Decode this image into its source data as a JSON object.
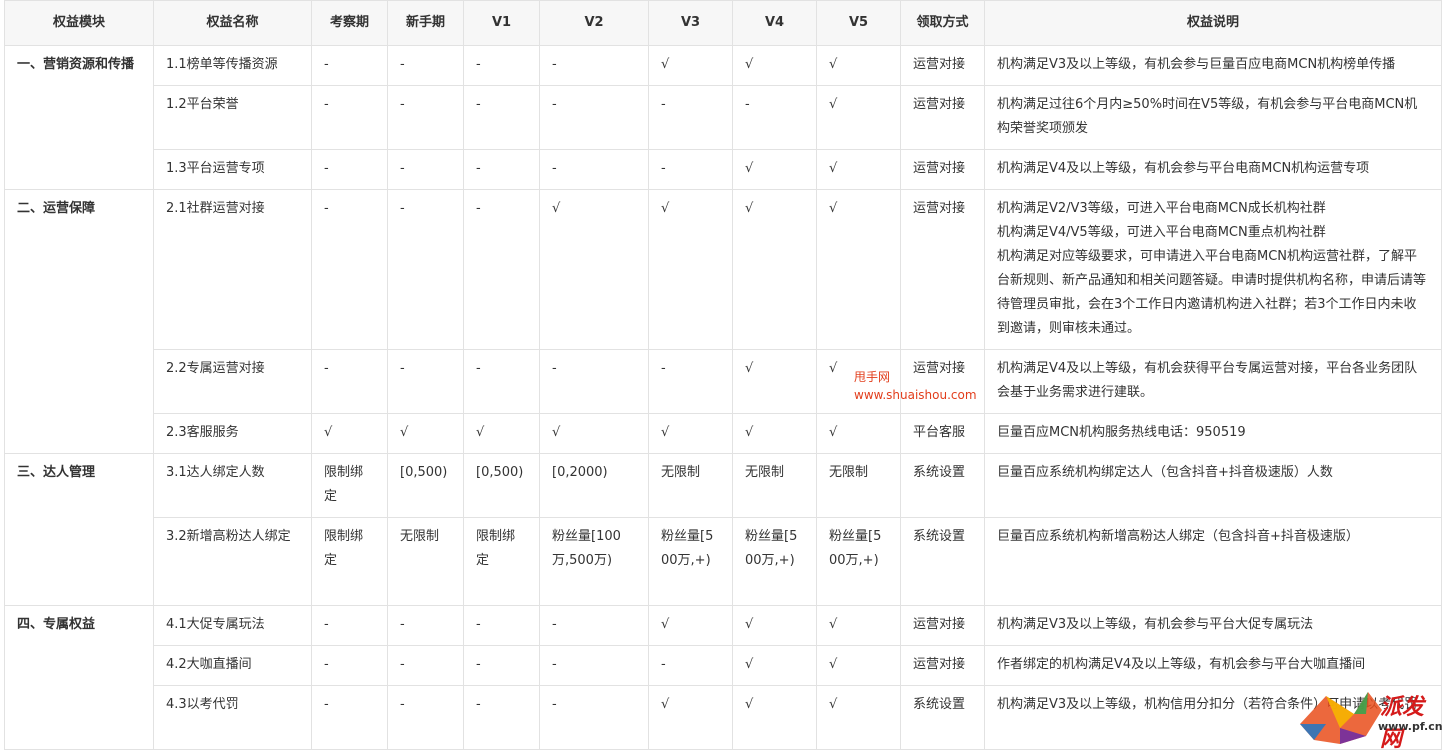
{
  "header": {
    "module": "权益模块",
    "name": "权益名称",
    "inspect": "考察期",
    "novice": "新手期",
    "v1": "V1",
    "v2": "V2",
    "v3": "V3",
    "v4": "V4",
    "v5": "V5",
    "method": "领取方式",
    "desc": "权益说明"
  },
  "modules": {
    "m1": "一、营销资源和传播",
    "m2": "二、运营保障",
    "m3": "三、达人管理",
    "m4": "四、专属权益"
  },
  "rows": [
    {
      "name": "1.1榜单等传播资源",
      "c": [
        "-",
        "-",
        "-",
        "-",
        "√",
        "√",
        "√"
      ],
      "method": "运营对接",
      "desc": "机构满足V3及以上等级，有机会参与巨量百应电商MCN机构榜单传播"
    },
    {
      "name": "1.2平台荣誉",
      "c": [
        "-",
        "-",
        "-",
        "-",
        "-",
        "-",
        "√"
      ],
      "method": "运营对接",
      "desc": "机构满足过往6个月内≥50%时间在V5等级，有机会参与平台电商MCN机构荣誉奖项颁发"
    },
    {
      "name": "1.3平台运营专项",
      "c": [
        "-",
        "-",
        "-",
        "-",
        "-",
        "√",
        "√"
      ],
      "method": "运营对接",
      "desc": "机构满足V4及以上等级，有机会参与平台电商MCN机构运营专项"
    },
    {
      "name": "2.1社群运营对接",
      "c": [
        "-",
        "-",
        "-",
        "√",
        "√",
        "√",
        "√"
      ],
      "method": "运营对接",
      "desc": "机构满足V2/V3等级，可进入平台电商MCN成长机构社群\n机构满足V4/V5等级，可进入平台电商MCN重点机构社群\n机构满足对应等级要求，可申请进入平台电商MCN机构运营社群，了解平台新规则、新产品通知和相关问题答疑。申请时提供机构名称，申请后请等待管理员审批，会在3个工作日内邀请机构进入社群；若3个工作日内未收到邀请，则审核未通过。"
    },
    {
      "name": "2.2专属运营对接",
      "c": [
        "-",
        "-",
        "-",
        "-",
        "-",
        "√",
        "√"
      ],
      "method": "运营对接",
      "desc": "机构满足V4及以上等级，有机会获得平台专属运营对接，平台各业务团队会基于业务需求进行建联。"
    },
    {
      "name": "2.3客服服务",
      "c": [
        "√",
        "√",
        "√",
        "√",
        "√",
        "√",
        "√"
      ],
      "method": "平台客服",
      "desc": "巨量百应MCN机构服务热线电话：950519"
    },
    {
      "name": "3.1达人绑定人数",
      "c": [
        "限制绑定",
        "[0,500)",
        "[0,500)",
        "[0,2000)",
        "无限制",
        "无限制",
        "无限制"
      ],
      "method": "系统设置",
      "desc": "巨量百应系统机构绑定达人（包含抖音+抖音极速版）人数"
    },
    {
      "name": "3.2新增高粉达人绑定",
      "c": [
        "限制绑定",
        "无限制",
        "限制绑定",
        "粉丝量[100万,500万)",
        "粉丝量[500万,+)",
        "粉丝量[500万,+)",
        "粉丝量[500万,+)"
      ],
      "method": "系统设置",
      "desc": "巨量百应系统机构新增高粉达人绑定（包含抖音+抖音极速版）"
    },
    {
      "name": "4.1大促专属玩法",
      "c": [
        "-",
        "-",
        "-",
        "-",
        "√",
        "√",
        "√"
      ],
      "method": "运营对接",
      "desc": "机构满足V3及以上等级，有机会参与平台大促专属玩法"
    },
    {
      "name": "4.2大咖直播间",
      "c": [
        "-",
        "-",
        "-",
        "-",
        "-",
        "√",
        "√"
      ],
      "method": "运营对接",
      "desc": "作者绑定的机构满足V4及以上等级，有机会参与平台大咖直播间"
    },
    {
      "name": "4.3以考代罚",
      "c": [
        "-",
        "-",
        "-",
        "-",
        "√",
        "√",
        "√"
      ],
      "method": "系统设置",
      "desc": "机构满足V3及以上等级，机构信用分扣分（若符合条件）可申请以考代罚"
    }
  ],
  "watermark": {
    "line1": "甩手网",
    "line2": "www.shuaishou.com"
  },
  "logo": {
    "text": "派发网",
    "url": "www.pf.cn"
  }
}
